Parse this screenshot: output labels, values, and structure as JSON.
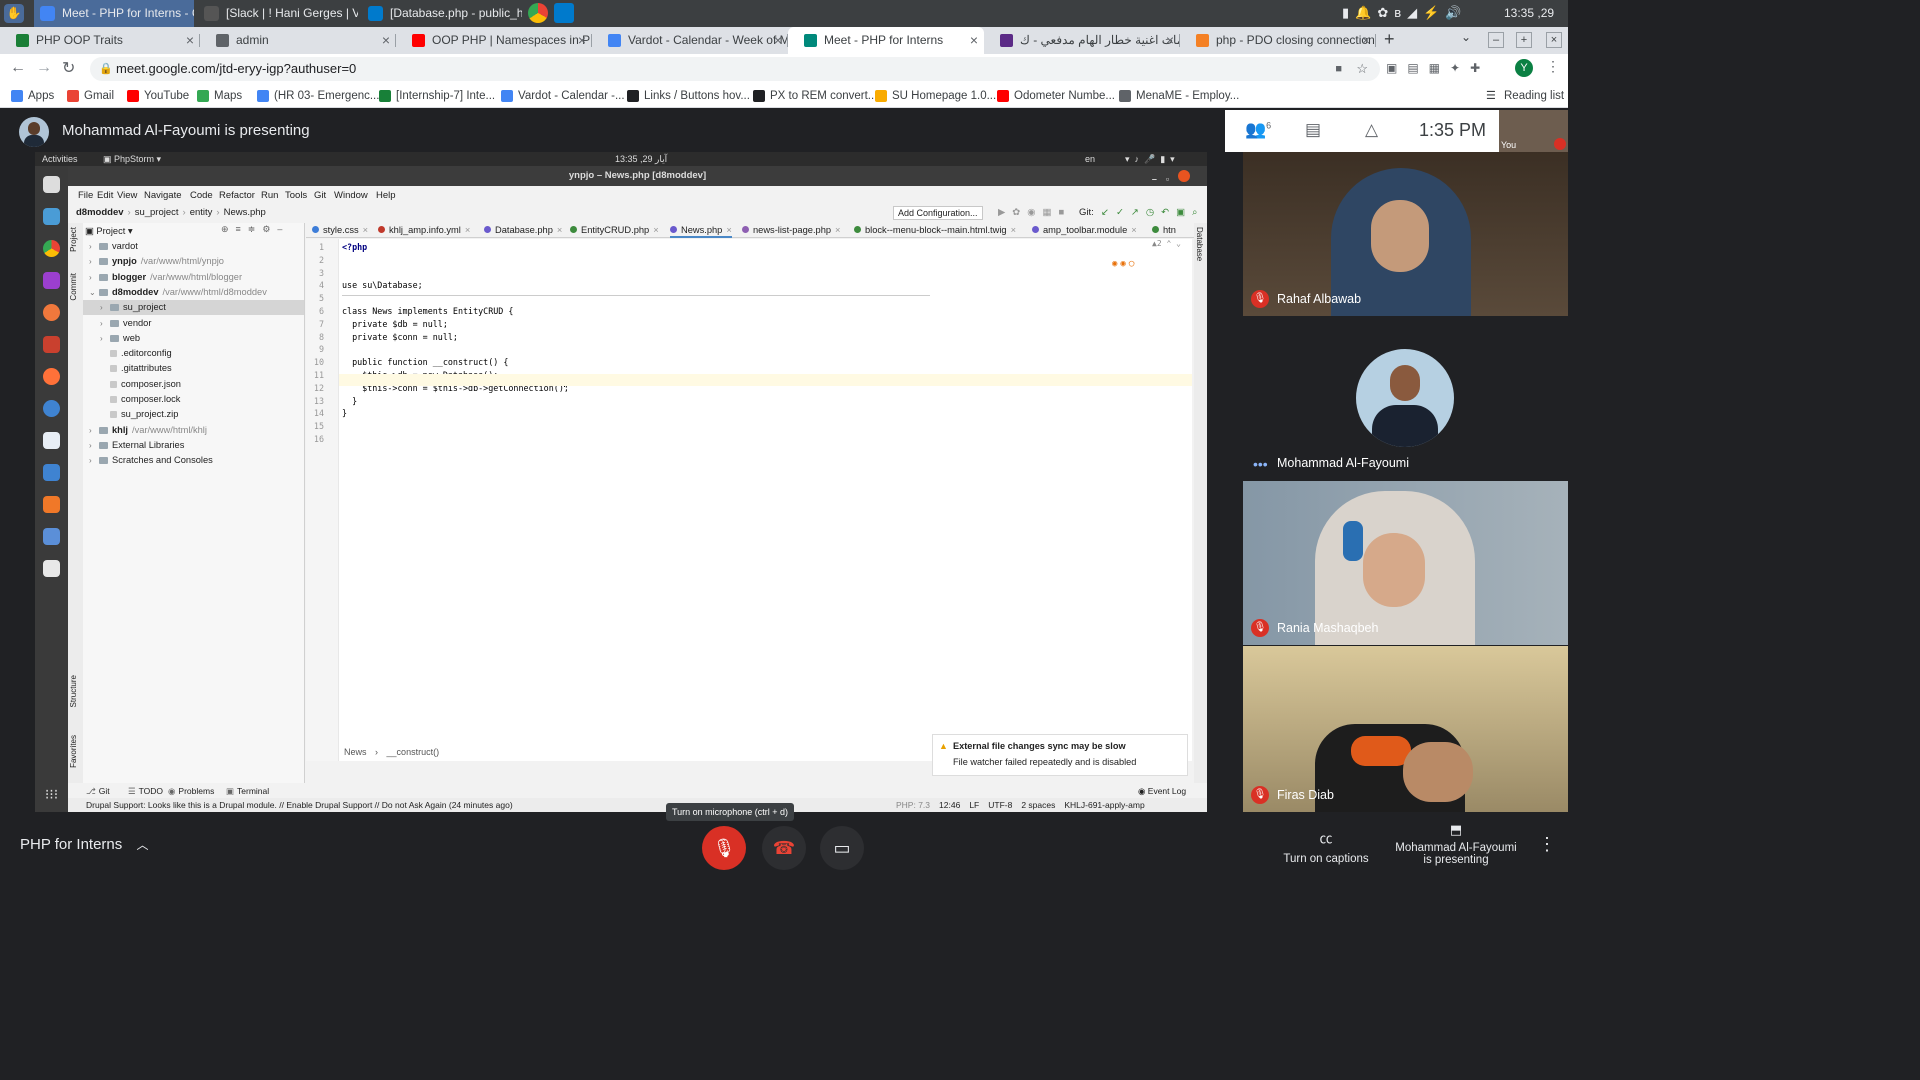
{
  "os_bar": {
    "tasks": [
      {
        "label": "Meet - PHP for Interns - Goo...",
        "active": true
      },
      {
        "label": "[Slack | ! Hani Gerges | Vard...",
        "active": false
      },
      {
        "label": "[Database.php - public_html ...",
        "active": false
      }
    ],
    "clock": "13:35 ,29 آيار"
  },
  "browser_tabs": [
    {
      "label": "PHP OOP Traits",
      "color": "#1a7f37"
    },
    {
      "label": "admin",
      "color": "#5f6368"
    },
    {
      "label": "OOP PHP | Namespaces in PHP",
      "color": "#ff0000"
    },
    {
      "label": "Vardot - Calendar - Week of Ma",
      "color": "#4285f4"
    },
    {
      "label": "Meet - PHP for Interns",
      "color": "#00897b",
      "active": true
    },
    {
      "label": "كلمات اغنية خطار الهام مدفعي - ك",
      "color": "#5b2a86"
    },
    {
      "label": "php - PDO closing connection -",
      "color": "#f48024"
    }
  ],
  "address": {
    "url": "meet.google.com/jtd-eryy-igp?authuser=0",
    "profile_initial": "Y"
  },
  "bookmarks": [
    {
      "label": "Apps",
      "color": "#4285f4"
    },
    {
      "label": "Gmail",
      "color": "#ea4335"
    },
    {
      "label": "YouTube",
      "color": "#ff0000"
    },
    {
      "label": "Maps",
      "color": "#34a853"
    },
    {
      "label": "(HR 03- Emergenc...",
      "color": "#4285f4"
    },
    {
      "label": "[Internship-7] Inte...",
      "color": "#188038"
    },
    {
      "label": "Vardot - Calendar -...",
      "color": "#4285f4"
    },
    {
      "label": "Links / Buttons hov...",
      "color": "#202124"
    },
    {
      "label": "PX to REM convert...",
      "color": "#202124"
    },
    {
      "label": "SU Homepage 1.0...",
      "color": "#f9ab00"
    },
    {
      "label": "Odometer Numbe...",
      "color": "#ff0000"
    },
    {
      "label": "MenaME - Employ...",
      "color": "#5f6368"
    }
  ],
  "reading_list": "Reading list",
  "meet": {
    "presenting_banner": "Mohammad Al-Fayoumi is presenting",
    "time": "1:35 PM",
    "self_label": "You",
    "participants_count": "6",
    "meeting_name": "PHP for Interns",
    "mic_tooltip": "Turn on microphone (ctrl + d)",
    "captions_label": "Turn on captions",
    "presenting_label_line1": "Mohammad Al-Fayoumi",
    "presenting_label_line2": "is presenting",
    "participants": [
      {
        "name": "Rahaf Albawab",
        "muted": true,
        "bg": "#4a4038"
      },
      {
        "name": "Mohammad Al-Fayoumi",
        "muted": false,
        "bg": "#202124"
      },
      {
        "name": "Rania Mashaqbeh",
        "muted": true,
        "bg": "#6b7a86"
      },
      {
        "name": "Firas Diab",
        "muted": true,
        "bg": "#8a7a5a"
      }
    ]
  },
  "ubuntu": {
    "activities": "Activities",
    "app": "PhpStorm",
    "clock": "13:35 ,29 آيار",
    "lang": "en"
  },
  "ide": {
    "title": "ynpjo – News.php [d8moddev]",
    "menu": [
      "File",
      "Edit",
      "View",
      "Navigate",
      "Code",
      "Refactor",
      "Run",
      "Tools",
      "Git",
      "Window",
      "Help"
    ],
    "breadcrumb": [
      "d8moddev",
      "su_project",
      "entity",
      "News.php"
    ],
    "add_config": "Add Configuration...",
    "git_label": "Git:",
    "project_label": "Project",
    "tree": [
      {
        "name": "vardot",
        "path": "",
        "depth": 0,
        "bold": false,
        "selected": false
      },
      {
        "name": "ynpjo",
        "path": "/var/www/html/ynpjo",
        "depth": 0,
        "bold": true,
        "selected": false
      },
      {
        "name": "blogger",
        "path": "/var/www/html/blogger",
        "depth": 0,
        "bold": true,
        "selected": false
      },
      {
        "name": "d8moddev",
        "path": "/var/www/html/d8moddev",
        "depth": 0,
        "bold": true,
        "selected": false
      },
      {
        "name": "su_project",
        "path": "",
        "depth": 1,
        "bold": false,
        "selected": true
      },
      {
        "name": "vendor",
        "path": "",
        "depth": 1,
        "bold": false,
        "selected": false
      },
      {
        "name": "web",
        "path": "",
        "depth": 1,
        "bold": false,
        "selected": false
      },
      {
        "name": ".editorconfig",
        "path": "",
        "depth": 1,
        "bold": false,
        "selected": false
      },
      {
        "name": ".gitattributes",
        "path": "",
        "depth": 1,
        "bold": false,
        "selected": false
      },
      {
        "name": "composer.json",
        "path": "",
        "depth": 1,
        "bold": false,
        "selected": false
      },
      {
        "name": "composer.lock",
        "path": "",
        "depth": 1,
        "bold": false,
        "selected": false
      },
      {
        "name": "su_project.zip",
        "path": "",
        "depth": 1,
        "bold": false,
        "selected": false
      },
      {
        "name": "khlj",
        "path": "/var/www/html/khlj",
        "depth": 0,
        "bold": true,
        "selected": false
      },
      {
        "name": "External Libraries",
        "path": "",
        "depth": 0,
        "bold": false,
        "selected": false
      },
      {
        "name": "Scratches and Consoles",
        "path": "",
        "depth": 0,
        "bold": false,
        "selected": false
      }
    ],
    "editor_tabs": [
      "style.css",
      "khlj_amp.info.yml",
      "Database.php",
      "EntityCRUD.php",
      "News.php",
      "news-list-page.php",
      "block--menu-block--main.html.twig",
      "amp_toolbar.module",
      "htn"
    ],
    "code_lines": [
      "<?php",
      "",
      "",
      "use su\\Database;",
      "",
      "class News implements EntityCRUD {",
      "  private $db = null;",
      "  private $conn = null;",
      "",
      "  public function __construct() {",
      "    $this->db = new Database();",
      "    $this->conn = $this->db->getConnection();",
      "  }",
      "}",
      "",
      ""
    ],
    "editor_breadcrumb": [
      "News",
      "__construct()"
    ],
    "notification": {
      "title": "External file changes sync may be slow",
      "body": "File watcher failed repeatedly and is disabled"
    },
    "bottom_tabs": [
      "Git",
      "TODO",
      "Problems",
      "Terminal"
    ],
    "event_log": "Event Log",
    "status_message": "Drupal Support: Looks like this is a Drupal module. // Enable Drupal Support // Do not Ask Again (24 minutes ago)",
    "status_right": [
      "PHP: 7.3",
      "12:46",
      "LF",
      "UTF-8",
      "2 spaces",
      "KHLJ-691-apply-amp"
    ],
    "left_strip": [
      "Project",
      "Commit",
      "Structure",
      "Favorites"
    ],
    "right_strip": "Database"
  }
}
